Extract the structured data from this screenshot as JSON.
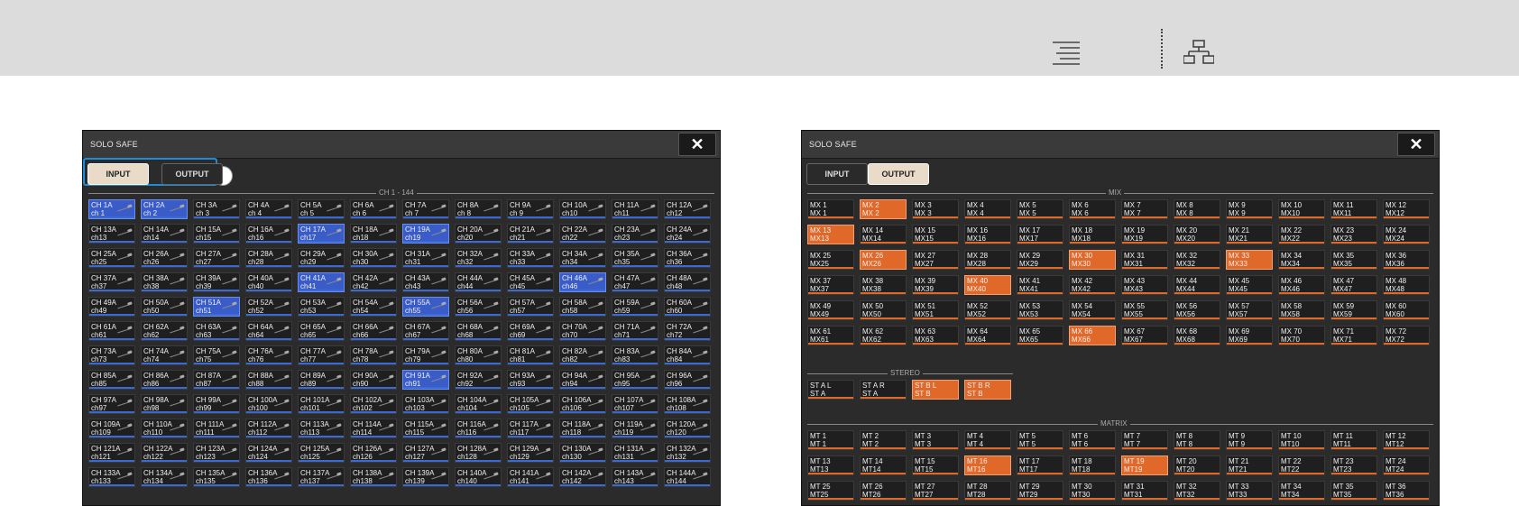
{
  "toolbar": {
    "icons": [
      "align-right-icon",
      "network-tree-icon"
    ]
  },
  "left_panel": {
    "title": "SOLO SAFE",
    "close_label": "✕",
    "tabs": [
      {
        "label": "INPUT",
        "active": true
      },
      {
        "label": "OUTPUT",
        "active": false
      }
    ],
    "section_label": "CH 1 - 144",
    "active_channels": [
      1,
      2,
      17,
      19,
      41,
      46,
      51,
      55,
      91
    ],
    "channels": [
      [
        "CH 1A",
        "ch 1"
      ],
      [
        "CH 2A",
        "ch 2"
      ],
      [
        "CH 3A",
        "ch 3"
      ],
      [
        "CH 4A",
        "ch 4"
      ],
      [
        "CH 5A",
        "ch 5"
      ],
      [
        "CH 6A",
        "ch 6"
      ],
      [
        "CH 7A",
        "ch 7"
      ],
      [
        "CH 8A",
        "ch 8"
      ],
      [
        "CH 9A",
        "ch 9"
      ],
      [
        "CH 10A",
        "ch10"
      ],
      [
        "CH 11A",
        "ch11"
      ],
      [
        "CH 12A",
        "ch12"
      ],
      [
        "CH 13A",
        "ch13"
      ],
      [
        "CH 14A",
        "ch14"
      ],
      [
        "CH 15A",
        "ch15"
      ],
      [
        "CH 16A",
        "ch16"
      ],
      [
        "CH 17A",
        "ch17"
      ],
      [
        "CH 18A",
        "ch18"
      ],
      [
        "CH 19A",
        "ch19"
      ],
      [
        "CH 20A",
        "ch20"
      ],
      [
        "CH 21A",
        "ch21"
      ],
      [
        "CH 22A",
        "ch22"
      ],
      [
        "CH 23A",
        "ch23"
      ],
      [
        "CH 24A",
        "ch24"
      ],
      [
        "CH 25A",
        "ch25"
      ],
      [
        "CH 26A",
        "ch26"
      ],
      [
        "CH 27A",
        "ch27"
      ],
      [
        "CH 28A",
        "ch28"
      ],
      [
        "CH 29A",
        "ch29"
      ],
      [
        "CH 30A",
        "ch30"
      ],
      [
        "CH 31A",
        "ch31"
      ],
      [
        "CH 32A",
        "ch32"
      ],
      [
        "CH 33A",
        "ch33"
      ],
      [
        "CH 34A",
        "ch34"
      ],
      [
        "CH 35A",
        "ch35"
      ],
      [
        "CH 36A",
        "ch36"
      ],
      [
        "CH 37A",
        "ch37"
      ],
      [
        "CH 38A",
        "ch38"
      ],
      [
        "CH 39A",
        "ch39"
      ],
      [
        "CH 40A",
        "ch40"
      ],
      [
        "CH 41A",
        "ch41"
      ],
      [
        "CH 42A",
        "ch42"
      ],
      [
        "CH 43A",
        "ch43"
      ],
      [
        "CH 44A",
        "ch44"
      ],
      [
        "CH 45A",
        "ch45"
      ],
      [
        "CH 46A",
        "ch46"
      ],
      [
        "CH 47A",
        "ch47"
      ],
      [
        "CH 48A",
        "ch48"
      ],
      [
        "CH 49A",
        "ch49"
      ],
      [
        "CH 50A",
        "ch50"
      ],
      [
        "CH 51A",
        "ch51"
      ],
      [
        "CH 52A",
        "ch52"
      ],
      [
        "CH 53A",
        "ch53"
      ],
      [
        "CH 54A",
        "ch54"
      ],
      [
        "CH 55A",
        "ch55"
      ],
      [
        "CH 56A",
        "ch56"
      ],
      [
        "CH 57A",
        "ch57"
      ],
      [
        "CH 58A",
        "ch58"
      ],
      [
        "CH 59A",
        "ch59"
      ],
      [
        "CH 60A",
        "ch60"
      ],
      [
        "CH 61A",
        "ch61"
      ],
      [
        "CH 62A",
        "ch62"
      ],
      [
        "CH 63A",
        "ch63"
      ],
      [
        "CH 64A",
        "ch64"
      ],
      [
        "CH 65A",
        "ch65"
      ],
      [
        "CH 66A",
        "ch66"
      ],
      [
        "CH 67A",
        "ch67"
      ],
      [
        "CH 68A",
        "ch68"
      ],
      [
        "CH 69A",
        "ch69"
      ],
      [
        "CH 70A",
        "ch70"
      ],
      [
        "CH 71A",
        "ch71"
      ],
      [
        "CH 72A",
        "ch72"
      ],
      [
        "CH 73A",
        "ch73"
      ],
      [
        "CH 74A",
        "ch74"
      ],
      [
        "CH 75A",
        "ch75"
      ],
      [
        "CH 76A",
        "ch76"
      ],
      [
        "CH 77A",
        "ch77"
      ],
      [
        "CH 78A",
        "ch78"
      ],
      [
        "CH 79A",
        "ch79"
      ],
      [
        "CH 80A",
        "ch80"
      ],
      [
        "CH 81A",
        "ch81"
      ],
      [
        "CH 82A",
        "ch82"
      ],
      [
        "CH 83A",
        "ch83"
      ],
      [
        "CH 84A",
        "ch84"
      ],
      [
        "CH 85A",
        "ch85"
      ],
      [
        "CH 86A",
        "ch86"
      ],
      [
        "CH 87A",
        "ch87"
      ],
      [
        "CH 88A",
        "ch88"
      ],
      [
        "CH 89A",
        "ch89"
      ],
      [
        "CH 90A",
        "ch90"
      ],
      [
        "CH 91A",
        "ch91"
      ],
      [
        "CH 92A",
        "ch92"
      ],
      [
        "CH 93A",
        "ch93"
      ],
      [
        "CH 94A",
        "ch94"
      ],
      [
        "CH 95A",
        "ch95"
      ],
      [
        "CH 96A",
        "ch96"
      ],
      [
        "CH 97A",
        "ch97"
      ],
      [
        "CH 98A",
        "ch98"
      ],
      [
        "CH 99A",
        "ch99"
      ],
      [
        "CH 100A",
        "ch100"
      ],
      [
        "CH 101A",
        "ch101"
      ],
      [
        "CH 102A",
        "ch102"
      ],
      [
        "CH 103A",
        "ch103"
      ],
      [
        "CH 104A",
        "ch104"
      ],
      [
        "CH 105A",
        "ch105"
      ],
      [
        "CH 106A",
        "ch106"
      ],
      [
        "CH 107A",
        "ch107"
      ],
      [
        "CH 108A",
        "ch108"
      ],
      [
        "CH 109A",
        "ch109"
      ],
      [
        "CH 110A",
        "ch110"
      ],
      [
        "CH 111A",
        "ch111"
      ],
      [
        "CH 112A",
        "ch112"
      ],
      [
        "CH 113A",
        "ch113"
      ],
      [
        "CH 114A",
        "ch114"
      ],
      [
        "CH 115A",
        "ch115"
      ],
      [
        "CH 116A",
        "ch116"
      ],
      [
        "CH 117A",
        "ch117"
      ],
      [
        "CH 118A",
        "ch118"
      ],
      [
        "CH 119A",
        "ch119"
      ],
      [
        "CH 120A",
        "ch120"
      ],
      [
        "CH 121A",
        "ch121"
      ],
      [
        "CH 122A",
        "ch122"
      ],
      [
        "CH 123A",
        "ch123"
      ],
      [
        "CH 124A",
        "ch124"
      ],
      [
        "CH 125A",
        "ch125"
      ],
      [
        "CH 126A",
        "ch126"
      ],
      [
        "CH 127A",
        "ch127"
      ],
      [
        "CH 128A",
        "ch128"
      ],
      [
        "CH 129A",
        "ch129"
      ],
      [
        "CH 130A",
        "ch130"
      ],
      [
        "CH 131A",
        "ch131"
      ],
      [
        "CH 132A",
        "ch132"
      ],
      [
        "CH 133A",
        "ch133"
      ],
      [
        "CH 134A",
        "ch134"
      ],
      [
        "CH 135A",
        "ch135"
      ],
      [
        "CH 136A",
        "ch136"
      ],
      [
        "CH 137A",
        "ch137"
      ],
      [
        "CH 138A",
        "ch138"
      ],
      [
        "CH 139A",
        "ch139"
      ],
      [
        "CH 140A",
        "ch140"
      ],
      [
        "CH 141A",
        "ch141"
      ],
      [
        "CH 142A",
        "ch142"
      ],
      [
        "CH 143A",
        "ch143"
      ],
      [
        "CH 144A",
        "ch144"
      ]
    ]
  },
  "right_panel": {
    "title": "SOLO SAFE",
    "close_label": "✕",
    "tabs": [
      {
        "label": "INPUT",
        "active": false
      },
      {
        "label": "OUTPUT",
        "active": true
      }
    ],
    "mix": {
      "label": "MIX",
      "active": [
        2,
        13,
        26,
        30,
        33,
        40,
        66
      ],
      "items": [
        [
          "MX 1",
          "MX 1"
        ],
        [
          "MX 2",
          "MX 2"
        ],
        [
          "MX 3",
          "MX 3"
        ],
        [
          "MX 4",
          "MX 4"
        ],
        [
          "MX 5",
          "MX 5"
        ],
        [
          "MX 6",
          "MX 6"
        ],
        [
          "MX 7",
          "MX 7"
        ],
        [
          "MX 8",
          "MX 8"
        ],
        [
          "MX 9",
          "MX 9"
        ],
        [
          "MX 10",
          "MX10"
        ],
        [
          "MX 11",
          "MX11"
        ],
        [
          "MX 12",
          "MX12"
        ],
        [
          "MX 13",
          "MX13"
        ],
        [
          "MX 14",
          "MX14"
        ],
        [
          "MX 15",
          "MX15"
        ],
        [
          "MX 16",
          "MX16"
        ],
        [
          "MX 17",
          "MX17"
        ],
        [
          "MX 18",
          "MX18"
        ],
        [
          "MX 19",
          "MX19"
        ],
        [
          "MX 20",
          "MX20"
        ],
        [
          "MX 21",
          "MX21"
        ],
        [
          "MX 22",
          "MX22"
        ],
        [
          "MX 23",
          "MX23"
        ],
        [
          "MX 24",
          "MX24"
        ],
        [
          "MX 25",
          "MX25"
        ],
        [
          "MX 26",
          "MX26"
        ],
        [
          "MX 27",
          "MX27"
        ],
        [
          "MX 28",
          "MX28"
        ],
        [
          "MX 29",
          "MX29"
        ],
        [
          "MX 30",
          "MX30"
        ],
        [
          "MX 31",
          "MX31"
        ],
        [
          "MX 32",
          "MX32"
        ],
        [
          "MX 33",
          "MX33"
        ],
        [
          "MX 34",
          "MX34"
        ],
        [
          "MX 35",
          "MX35"
        ],
        [
          "MX 36",
          "MX36"
        ],
        [
          "MX 37",
          "MX37"
        ],
        [
          "MX 38",
          "MX38"
        ],
        [
          "MX 39",
          "MX39"
        ],
        [
          "MX 40",
          "MX40"
        ],
        [
          "MX 41",
          "MX41"
        ],
        [
          "MX 42",
          "MX42"
        ],
        [
          "MX 43",
          "MX43"
        ],
        [
          "MX 44",
          "MX44"
        ],
        [
          "MX 45",
          "MX45"
        ],
        [
          "MX 46",
          "MX46"
        ],
        [
          "MX 47",
          "MX47"
        ],
        [
          "MX 48",
          "MX48"
        ],
        [
          "MX 49",
          "MX49"
        ],
        [
          "MX 50",
          "MX50"
        ],
        [
          "MX 51",
          "MX51"
        ],
        [
          "MX 52",
          "MX52"
        ],
        [
          "MX 53",
          "MX53"
        ],
        [
          "MX 54",
          "MX54"
        ],
        [
          "MX 55",
          "MX55"
        ],
        [
          "MX 56",
          "MX56"
        ],
        [
          "MX 57",
          "MX57"
        ],
        [
          "MX 58",
          "MX58"
        ],
        [
          "MX 59",
          "MX59"
        ],
        [
          "MX 60",
          "MX60"
        ],
        [
          "MX 61",
          "MX61"
        ],
        [
          "MX 62",
          "MX62"
        ],
        [
          "MX 63",
          "MX63"
        ],
        [
          "MX 64",
          "MX64"
        ],
        [
          "MX 65",
          "MX65"
        ],
        [
          "MX 66",
          "MX66"
        ],
        [
          "MX 67",
          "MX67"
        ],
        [
          "MX 68",
          "MX68"
        ],
        [
          "MX 69",
          "MX69"
        ],
        [
          "MX 70",
          "MX70"
        ],
        [
          "MX 71",
          "MX71"
        ],
        [
          "MX 72",
          "MX72"
        ]
      ]
    },
    "stereo": {
      "label": "STEREO",
      "active": [
        3,
        4
      ],
      "items": [
        [
          "ST A L",
          "ST A"
        ],
        [
          "ST A R",
          "ST A"
        ],
        [
          "ST B L",
          "ST B"
        ],
        [
          "ST B R",
          "ST B"
        ]
      ]
    },
    "matrix": {
      "label": "MATRIX",
      "active": [
        16,
        19
      ],
      "items": [
        [
          "MT 1",
          "MT 1"
        ],
        [
          "MT 2",
          "MT 2"
        ],
        [
          "MT 3",
          "MT 3"
        ],
        [
          "MT 4",
          "MT 4"
        ],
        [
          "MT 5",
          "MT 5"
        ],
        [
          "MT 6",
          "MT 6"
        ],
        [
          "MT 7",
          "MT 7"
        ],
        [
          "MT 8",
          "MT 8"
        ],
        [
          "MT 9",
          "MT 9"
        ],
        [
          "MT 10",
          "MT10"
        ],
        [
          "MT 11",
          "MT11"
        ],
        [
          "MT 12",
          "MT12"
        ],
        [
          "MT 13",
          "MT13"
        ],
        [
          "MT 14",
          "MT14"
        ],
        [
          "MT 15",
          "MT15"
        ],
        [
          "MT 16",
          "MT16"
        ],
        [
          "MT 17",
          "MT17"
        ],
        [
          "MT 18",
          "MT18"
        ],
        [
          "MT 19",
          "MT19"
        ],
        [
          "MT 20",
          "MT20"
        ],
        [
          "MT 21",
          "MT21"
        ],
        [
          "MT 22",
          "MT22"
        ],
        [
          "MT 23",
          "MT23"
        ],
        [
          "MT 24",
          "MT24"
        ],
        [
          "MT 25",
          "MT25"
        ],
        [
          "MT 26",
          "MT26"
        ],
        [
          "MT 27",
          "MT27"
        ],
        [
          "MT 28",
          "MT28"
        ],
        [
          "MT 29",
          "MT29"
        ],
        [
          "MT 30",
          "MT30"
        ],
        [
          "MT 31",
          "MT31"
        ],
        [
          "MT 32",
          "MT32"
        ],
        [
          "MT 33",
          "MT33"
        ],
        [
          "MT 34",
          "MT34"
        ],
        [
          "MT 35",
          "MT35"
        ],
        [
          "MT 36",
          "MT36"
        ]
      ]
    }
  },
  "colors": {
    "channel_on": "#3a5cc8",
    "output_on": "#e0692a",
    "callout": "#1e8cd8"
  }
}
